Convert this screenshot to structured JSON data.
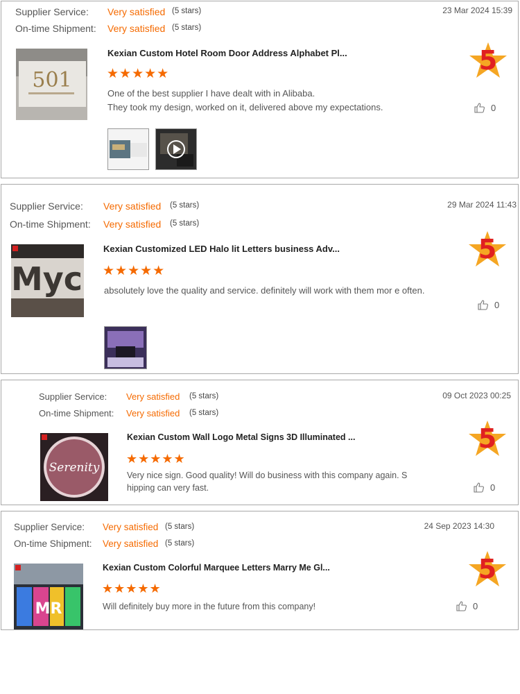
{
  "labels": {
    "supplier_service": "Supplier Service:",
    "on_time_shipment": "On-time Shipment:"
  },
  "colors": {
    "accent": "#f56a00",
    "badge_star": "#f5a623",
    "badge_number": "#e02020"
  },
  "reviews": [
    {
      "supplier_service": "Very satisfied",
      "supplier_service_note": "(5 stars)",
      "on_time_shipment": "Very satisfied",
      "on_time_shipment_note": "(5 stars)",
      "date": "23 Mar 2024 15:39",
      "product_title": "Kexian Custom Hotel Room Door Address Alphabet Pl...",
      "rating": 5,
      "stars": "★★★★★",
      "badge": "5",
      "text": "One of the best supplier I have dealt with in Alibaba.\nThey took my design, worked on it, delivered above my expectations.",
      "likes": "0",
      "product_image": {
        "icon": "door-number-plate",
        "text": "501"
      },
      "media": [
        "photo",
        "video"
      ]
    },
    {
      "supplier_service": "Very satisfied",
      "supplier_service_note": "(5 stars)",
      "on_time_shipment": "Very satisfied",
      "on_time_shipment_note": "(5 stars)",
      "date": "29 Mar 2024 11:43",
      "product_title": "Kexian Customized LED Halo lit Letters business Adv...",
      "rating": 5,
      "stars": "★★★★★",
      "badge": "5",
      "text": "absolutely love the quality and service. definitely will work with them mor e often.",
      "likes": "0",
      "product_image": {
        "icon": "halo-lit-letters",
        "text": "Myc"
      },
      "media": [
        "photo"
      ]
    },
    {
      "supplier_service": "Very satisfied",
      "supplier_service_note": "(5 stars)",
      "on_time_shipment": "Very satisfied",
      "on_time_shipment_note": "(5 stars)",
      "date": "09 Oct 2023 00:25",
      "product_title": "Kexian Custom Wall Logo Metal Signs 3D Illuminated ...",
      "rating": 5,
      "stars": "★★★★★",
      "badge": "5",
      "text": "Very nice sign. Good quality! Will do business with this company again. S hipping can very fast.",
      "likes": "0",
      "product_image": {
        "icon": "illuminated-logo-sign",
        "text": "Serenity"
      },
      "media": []
    },
    {
      "supplier_service": "Very satisfied",
      "supplier_service_note": "(5 stars)",
      "on_time_shipment": "Very satisfied",
      "on_time_shipment_note": "(5 stars)",
      "date": "24 Sep 2023 14:30",
      "product_title": "Kexian Custom Colorful Marquee Letters Marry Me Gl...",
      "rating": 5,
      "stars": "★★★★★",
      "badge": "5",
      "text": "Will definitely buy more in the future from this company!",
      "likes": "0",
      "product_image": {
        "icon": "marquee-letters",
        "text": "MR"
      },
      "media": []
    }
  ]
}
